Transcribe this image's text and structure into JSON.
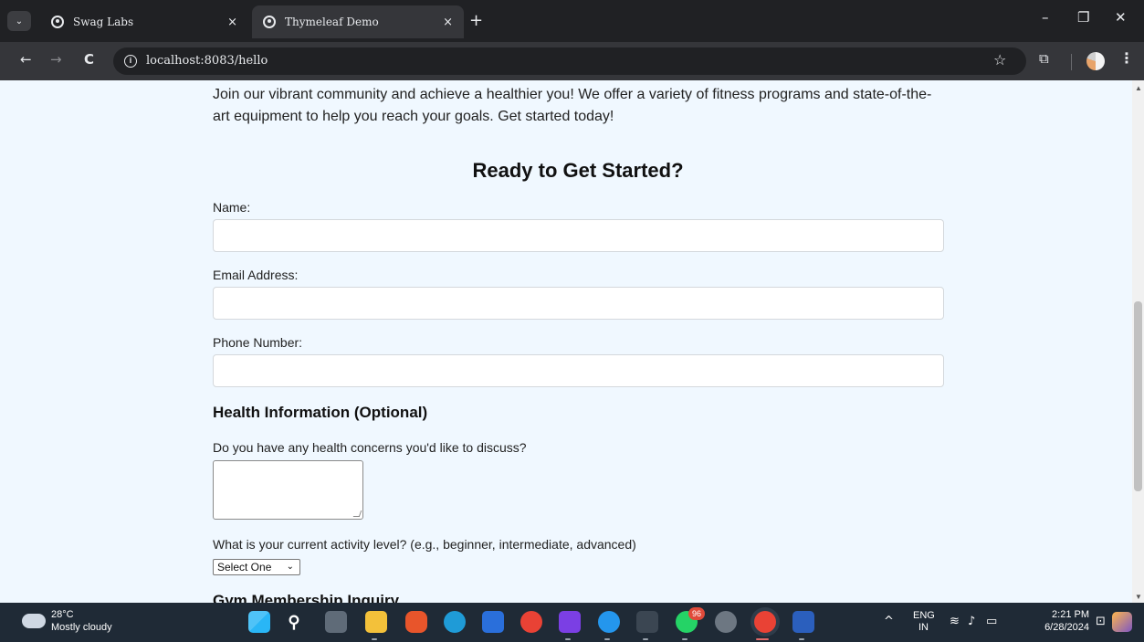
{
  "browser": {
    "tabs": [
      {
        "title": "Swag Labs",
        "active": false
      },
      {
        "title": "Thymeleaf Demo",
        "active": true
      }
    ],
    "url": "localhost:8083/hello",
    "icons": {
      "tab_search": "chevron-down-icon",
      "close": "×",
      "new_tab": "+",
      "minimize": "–",
      "restore": "❐",
      "window_close": "✕",
      "back": "←",
      "forward": "→",
      "reload": "C",
      "site_info": "i",
      "star": "☆",
      "extensions": "⧉",
      "menu": "⋮"
    }
  },
  "page": {
    "intro": "Join our vibrant community and achieve a healthier you! We offer a variety of fitness programs and state-of-the-art equipment to help you reach your goals. Get started today!",
    "cta_heading": "Ready to Get Started?",
    "fields": {
      "name_label": "Name:",
      "name_value": "",
      "email_label": "Email Address:",
      "email_value": "",
      "phone_label": "Phone Number:",
      "phone_value": ""
    },
    "health_section": {
      "title": "Health Information (Optional)",
      "concerns_label": "Do you have any health concerns you'd like to discuss?",
      "concerns_value": "",
      "activity_label": "What is your current activity level? (e.g., beginner, intermediate, advanced)",
      "activity_selected": "Select One"
    },
    "membership_section": {
      "title": "Gym Membership Inquiry"
    },
    "colors": {
      "page_background": "#f0f8ff",
      "text": "#222222"
    }
  },
  "taskbar": {
    "weather": {
      "temp": "28°C",
      "desc": "Mostly cloudy"
    },
    "whatsapp_badge": "96",
    "language": {
      "line1": "ENG",
      "line2": "IN"
    },
    "clock": {
      "time": "2:21 PM",
      "date": "6/28/2024"
    }
  }
}
